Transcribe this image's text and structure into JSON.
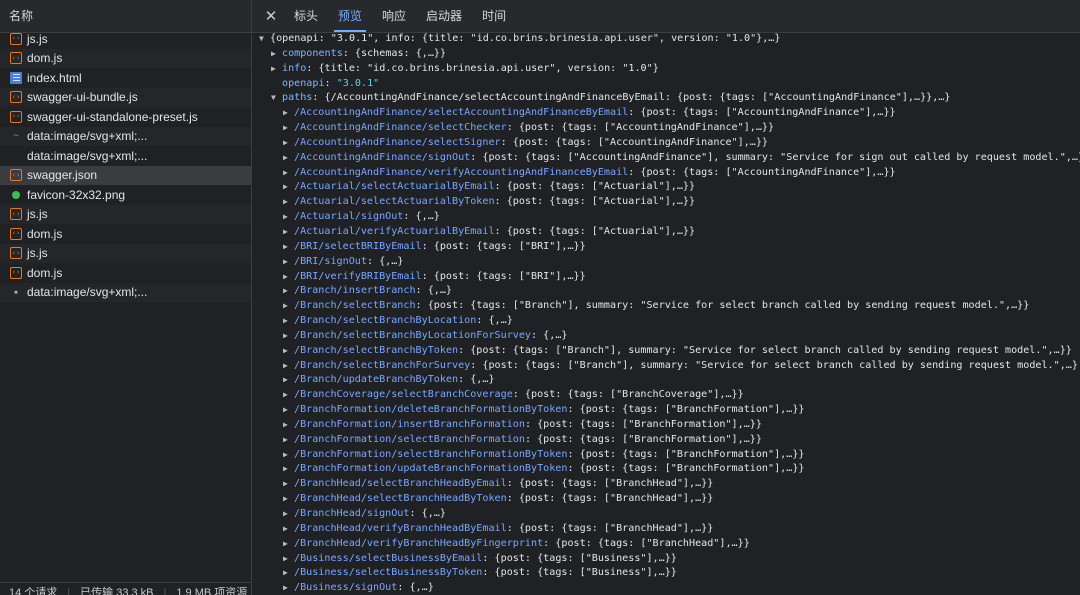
{
  "left": {
    "header": "名称",
    "requests": [
      {
        "icon": "js-file-icon",
        "name": "js.js"
      },
      {
        "icon": "js-file-icon",
        "name": "dom.js"
      },
      {
        "icon": "document-icon",
        "name": "index.html"
      },
      {
        "icon": "js-file-icon",
        "name": "swagger-ui-bundle.js"
      },
      {
        "icon": "js-file-icon",
        "name": "swagger-ui-standalone-preset.js"
      },
      {
        "icon": "svg-image-icon",
        "name": "data:image/svg+xml;..."
      },
      {
        "icon": "blank",
        "name": "data:image/svg+xml;..."
      },
      {
        "icon": "json-file-icon",
        "name": "swagger.json"
      },
      {
        "icon": "image-dot-icon",
        "name": "favicon-32x32.png"
      },
      {
        "icon": "js-file-icon",
        "name": "js.js"
      },
      {
        "icon": "js-file-icon",
        "name": "dom.js"
      },
      {
        "icon": "js-file-icon",
        "name": "js.js"
      },
      {
        "icon": "js-file-icon",
        "name": "dom.js"
      },
      {
        "icon": "small-image-icon",
        "name": "data:image/svg+xml;..."
      }
    ],
    "footer": {
      "requests": "14 个请求",
      "transferred": "已传输 33.3 kB",
      "resources": "1.9 MB 项资源"
    }
  },
  "tabs": [
    "标头",
    "预览",
    "响应",
    "启动器",
    "时间"
  ],
  "active_tab": "预览",
  "preview": {
    "root": "{openapi: \"3.0.1\", info: {title: \"id.co.brins.brinesia.api.user\", version: \"1.0\"},…}",
    "components_key": "components",
    "components_val": ": {schemas: {,…}}",
    "info_key": "info",
    "info_val": ": {title: \"id.co.brins.brinesia.api.user\", version: \"1.0\"}",
    "openapi_key": "openapi",
    "openapi_val": "\"3.0.1\"",
    "paths_key": "paths",
    "paths_val": ": {/AccountingAndFinance/selectAccountingAndFinanceByEmail: {post: {tags: [\"AccountingAndFinance\"],…}},…}",
    "paths": [
      {
        "p": "/AccountingAndFinance/selectAccountingAndFinanceByEmail",
        "v": ": {post: {tags: [\"AccountingAndFinance\"],…}}"
      },
      {
        "p": "/AccountingAndFinance/selectChecker",
        "v": ": {post: {tags: [\"AccountingAndFinance\"],…}}"
      },
      {
        "p": "/AccountingAndFinance/selectSigner",
        "v": ": {post: {tags: [\"AccountingAndFinance\"],…}}"
      },
      {
        "p": "/AccountingAndFinance/signOut",
        "v": ": {post: {tags: [\"AccountingAndFinance\"], summary: \"Service for sign out called by request model.\",…}"
      },
      {
        "p": "/AccountingAndFinance/verifyAccountingAndFinanceByEmail",
        "v": ": {post: {tags: [\"AccountingAndFinance\"],…}}"
      },
      {
        "p": "/Actuarial/selectActuarialByEmail",
        "v": ": {post: {tags: [\"Actuarial\"],…}}"
      },
      {
        "p": "/Actuarial/selectActuarialByToken",
        "v": ": {post: {tags: [\"Actuarial\"],…}}"
      },
      {
        "p": "/Actuarial/signOut",
        "v": ": {,…}"
      },
      {
        "p": "/Actuarial/verifyActuarialByEmail",
        "v": ": {post: {tags: [\"Actuarial\"],…}}"
      },
      {
        "p": "/BRI/selectBRIByEmail",
        "v": ": {post: {tags: [\"BRI\"],…}}"
      },
      {
        "p": "/BRI/signOut",
        "v": ": {,…}"
      },
      {
        "p": "/BRI/verifyBRIByEmail",
        "v": ": {post: {tags: [\"BRI\"],…}}"
      },
      {
        "p": "/Branch/insertBranch",
        "v": ": {,…}"
      },
      {
        "p": "/Branch/selectBranch",
        "v": ": {post: {tags: [\"Branch\"], summary: \"Service for select branch called by sending request model.\",…}}"
      },
      {
        "p": "/Branch/selectBranchByLocation",
        "v": ": {,…}"
      },
      {
        "p": "/Branch/selectBranchByLocationForSurvey",
        "v": ": {,…}"
      },
      {
        "p": "/Branch/selectBranchByToken",
        "v": ": {post: {tags: [\"Branch\"], summary: \"Service for select branch called by sending request model.\",…}}"
      },
      {
        "p": "/Branch/selectBranchForSurvey",
        "v": ": {post: {tags: [\"Branch\"], summary: \"Service for select branch called by sending request model.\",…}"
      },
      {
        "p": "/Branch/updateBranchByToken",
        "v": ": {,…}"
      },
      {
        "p": "/BranchCoverage/selectBranchCoverage",
        "v": ": {post: {tags: [\"BranchCoverage\"],…}}"
      },
      {
        "p": "/BranchFormation/deleteBranchFormationByToken",
        "v": ": {post: {tags: [\"BranchFormation\"],…}}"
      },
      {
        "p": "/BranchFormation/insertBranchFormation",
        "v": ": {post: {tags: [\"BranchFormation\"],…}}"
      },
      {
        "p": "/BranchFormation/selectBranchFormation",
        "v": ": {post: {tags: [\"BranchFormation\"],…}}"
      },
      {
        "p": "/BranchFormation/selectBranchFormationByToken",
        "v": ": {post: {tags: [\"BranchFormation\"],…}}"
      },
      {
        "p": "/BranchFormation/updateBranchFormationByToken",
        "v": ": {post: {tags: [\"BranchFormation\"],…}}"
      },
      {
        "p": "/BranchHead/selectBranchHeadByEmail",
        "v": ": {post: {tags: [\"BranchHead\"],…}}"
      },
      {
        "p": "/BranchHead/selectBranchHeadByToken",
        "v": ": {post: {tags: [\"BranchHead\"],…}}"
      },
      {
        "p": "/BranchHead/signOut",
        "v": ": {,…}"
      },
      {
        "p": "/BranchHead/verifyBranchHeadByEmail",
        "v": ": {post: {tags: [\"BranchHead\"],…}}"
      },
      {
        "p": "/BranchHead/verifyBranchHeadByFingerprint",
        "v": ": {post: {tags: [\"BranchHead\"],…}}"
      },
      {
        "p": "/Business/selectBusinessByEmail",
        "v": ": {post: {tags: [\"Business\"],…}}"
      },
      {
        "p": "/Business/selectBusinessByToken",
        "v": ": {post: {tags: [\"Business\"],…}}"
      },
      {
        "p": "/Business/signOut",
        "v": ": {,…}"
      }
    ]
  }
}
